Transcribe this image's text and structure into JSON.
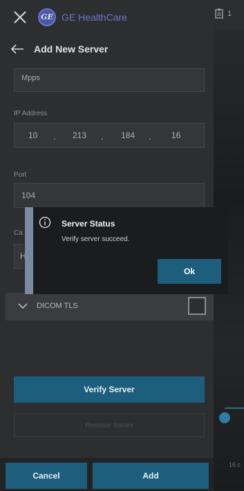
{
  "header": {
    "brand": "GE HealthCare",
    "logo_text": "GE"
  },
  "subheader": {
    "title": "Add New Server"
  },
  "form": {
    "name_value": "Mpps",
    "ip_label": "IP Address",
    "ip_parts": [
      "10",
      "213",
      "184",
      "16"
    ],
    "port_label": "Port",
    "port_value": "104",
    "partial_label": "Ca",
    "partial_value": "H"
  },
  "dialog": {
    "title": "Server Status",
    "message": "Verify server succeed.",
    "ok_label": "Ok"
  },
  "tls": {
    "label": "DICOM TLS",
    "checked": false
  },
  "actions": {
    "verify_label": "Verify Server",
    "remove_label": "Remove Server",
    "cancel_label": "Cancel",
    "add_label": "Add"
  },
  "viewer": {
    "count_text": "1",
    "faint_text": "16 c"
  },
  "colors": {
    "accent": "#1c5e7b",
    "brand": "#6b75c9",
    "panel": "#2c2e30"
  }
}
